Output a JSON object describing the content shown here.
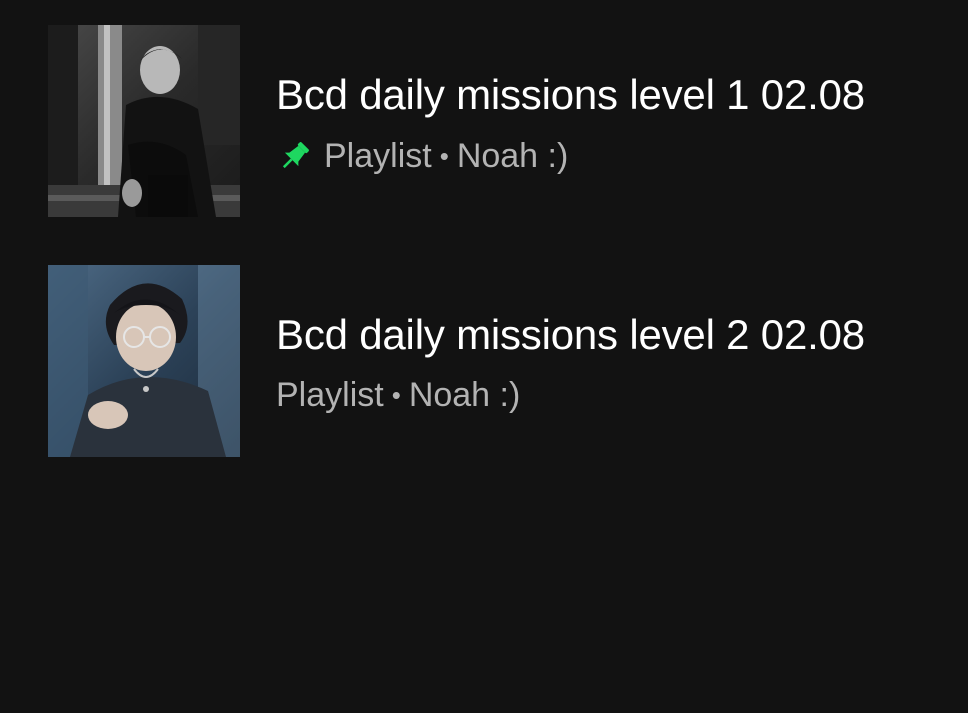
{
  "colors": {
    "background": "#121212",
    "title_text": "#ffffff",
    "subtitle_text": "#b3b3b3",
    "pin_accent": "#1ed760"
  },
  "items": [
    {
      "title": "Bcd daily missions level 1 02.08",
      "type": "Playlist",
      "separator": "•",
      "owner": "Noah :)",
      "pinned": true,
      "pin_icon": "pin-icon"
    },
    {
      "title": "Bcd daily missions level 2  02.08",
      "type": "Playlist",
      "separator": "•",
      "owner": "Noah :)",
      "pinned": false
    }
  ]
}
